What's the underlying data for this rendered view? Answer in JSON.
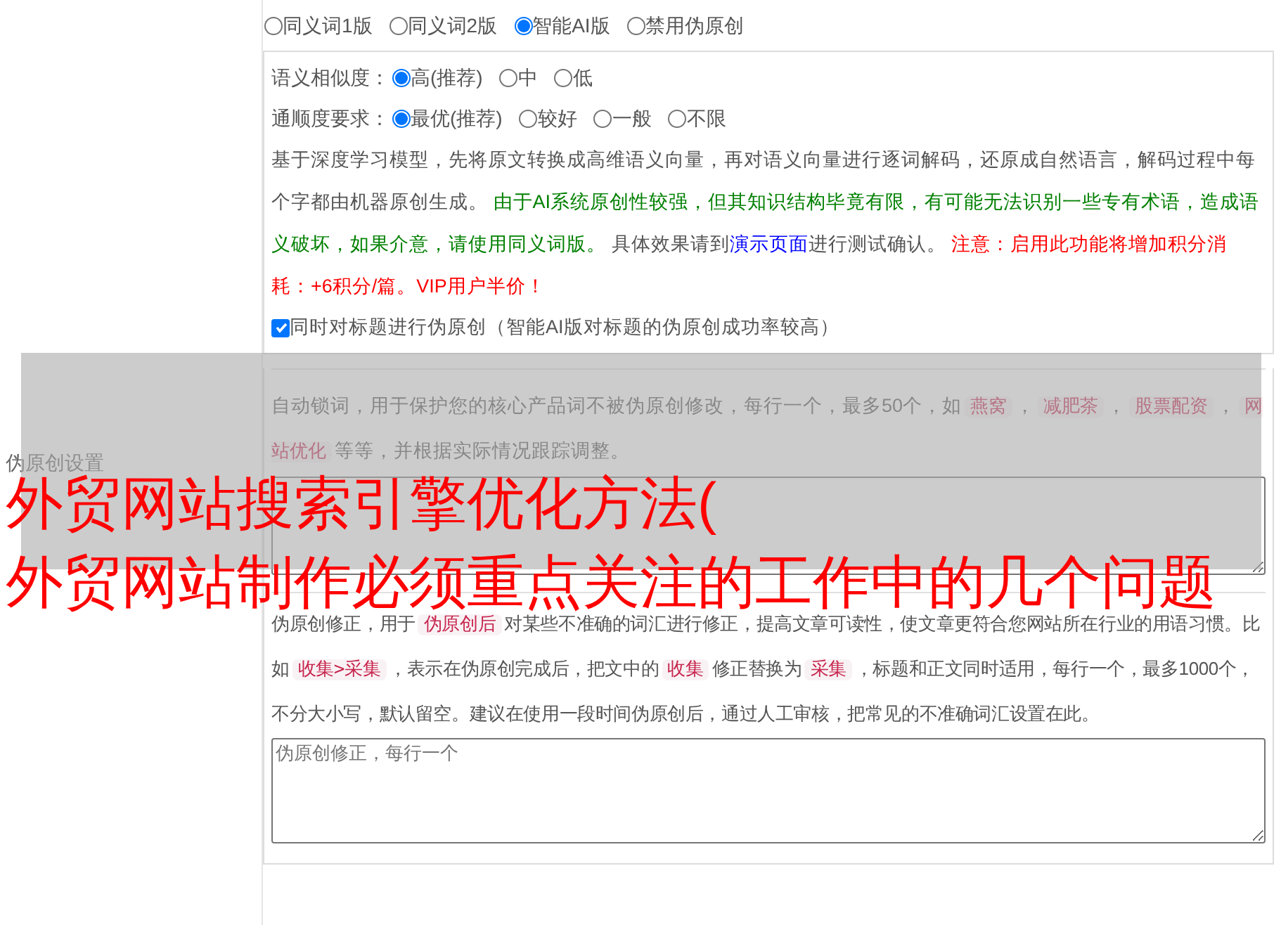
{
  "sidebar_label": "伪原创设置",
  "engine_options": [
    {
      "label": "同义词1版",
      "selected": false
    },
    {
      "label": "同义词2版",
      "selected": false
    },
    {
      "label": "智能AI版",
      "selected": true
    },
    {
      "label": "禁用伪原创",
      "selected": false
    }
  ],
  "similarity": {
    "label": "语义相似度：",
    "options": [
      {
        "label": "高(推荐)",
        "selected": true
      },
      {
        "label": "中",
        "selected": false
      },
      {
        "label": "低",
        "selected": false
      }
    ]
  },
  "fluency": {
    "label": "通顺度要求：",
    "options": [
      {
        "label": "最优(推荐)",
        "selected": true
      },
      {
        "label": "较好",
        "selected": false
      },
      {
        "label": "一般",
        "selected": false
      },
      {
        "label": "不限",
        "selected": false
      }
    ]
  },
  "description": {
    "intro": "基于深度学习模型，先将原文转换成高维语义向量，再对语义向量进行逐词解码，还原成自然语言，解码过程中每个字都由机器原创生成。",
    "caution": "由于AI系统原创性较强，但其知识结构毕竟有限，有可能无法识别一些专有术语，造成语义破坏，如果介意，请使用同义词版。",
    "test_prefix": "具体效果请到",
    "link": "演示页面",
    "test_suffix": "进行测试确认。",
    "notice": "注意：启用此功能将增加积分消耗：+6积分/篇。VIP用户半价！"
  },
  "title_checkbox": {
    "label": "同时对标题进行伪原创（智能AI版对标题的伪原创成功率较高）",
    "checked": true
  },
  "lock_words": {
    "segments": [
      {
        "kind": "text",
        "text": "自动锁词，用于保护您的核心产品词不被伪原创修改，每行一个，最多50个，如"
      },
      {
        "kind": "code",
        "text": "燕窝"
      },
      {
        "kind": "text",
        "text": "，"
      },
      {
        "kind": "code",
        "text": "减肥茶"
      },
      {
        "kind": "text",
        "text": "，"
      },
      {
        "kind": "code",
        "text": "股票配资"
      },
      {
        "kind": "text",
        "text": "，"
      },
      {
        "kind": "code",
        "text": "网站优化"
      },
      {
        "kind": "text",
        "text": "等等，并根据实际情况跟踪调整。"
      }
    ]
  },
  "correction": {
    "segments": [
      {
        "kind": "text",
        "text": "伪原创修正，用于"
      },
      {
        "kind": "code",
        "text": "伪原创后"
      },
      {
        "kind": "text",
        "text": "对某些不准确的词汇进行修正，提高文章可读性，使文章更符合您网站所在行业的用语习惯。比如"
      },
      {
        "kind": "code",
        "text": "收集>采集"
      },
      {
        "kind": "text",
        "text": "，表示在伪原创完成后，把文中的"
      },
      {
        "kind": "code",
        "text": "收集"
      },
      {
        "kind": "text",
        "text": "修正替换为"
      },
      {
        "kind": "code",
        "text": "采集"
      },
      {
        "kind": "text",
        "text": "，标题和正文同时适用，每行一个，最多1000个，不分大小写，默认留空。建议在使用一段时间伪原创后，通过人工审核，把常见的不准确词汇设置在此。"
      }
    ],
    "placeholder": "伪原创修正，每行一个"
  },
  "overlay_title": [
    "外贸网站搜索引擎优化方法(",
    "外贸网站制作必须重点关注的工作中的几个问题"
  ]
}
